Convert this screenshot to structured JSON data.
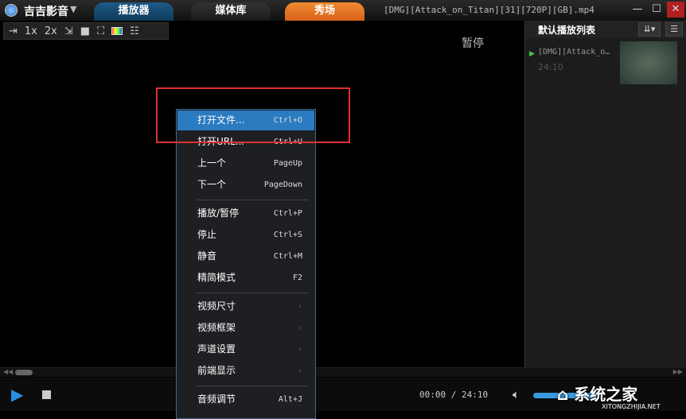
{
  "app": {
    "name": "吉吉影音",
    "filename": "[DMG][Attack_on_Titan][31][720P][GB].mp4"
  },
  "tabs": [
    {
      "label": "播放器"
    },
    {
      "label": "媒体库"
    },
    {
      "label": "秀场"
    }
  ],
  "toolbar": {
    "speed1": "1x",
    "speed2": "2x"
  },
  "playlist": {
    "title": "默认播放列表",
    "item": "[DMG][Attack_o…",
    "duration": "24:10"
  },
  "overlay_text": "暂停",
  "menu": [
    {
      "label": "打开文件...",
      "shortcut": "Ctrl+O"
    },
    {
      "label": "打开URL...",
      "shortcut": "Ctrl+U"
    },
    {
      "label": "上一个",
      "shortcut": "PageUp"
    },
    {
      "label": "下一个",
      "shortcut": "PageDown"
    },
    {
      "label": "播放/暂停",
      "shortcut": "Ctrl+P"
    },
    {
      "label": "停止",
      "shortcut": "Ctrl+S"
    },
    {
      "label": "静音",
      "shortcut": "Ctrl+M"
    },
    {
      "label": "精简模式",
      "shortcut": "F2"
    },
    {
      "label": "视频尺寸",
      "shortcut": "›"
    },
    {
      "label": "视频框架",
      "shortcut": "›"
    },
    {
      "label": "声道设置",
      "shortcut": "›"
    },
    {
      "label": "前端显示",
      "shortcut": "›"
    },
    {
      "label": "音频调节",
      "shortcut": "Alt+J"
    }
  ],
  "player": {
    "time": "00:00 / 24:10",
    "progress": 0,
    "volume": 0.8
  },
  "watermark": {
    "brand": "系统之家",
    "url": "XITONGZHIJIA.NET"
  }
}
